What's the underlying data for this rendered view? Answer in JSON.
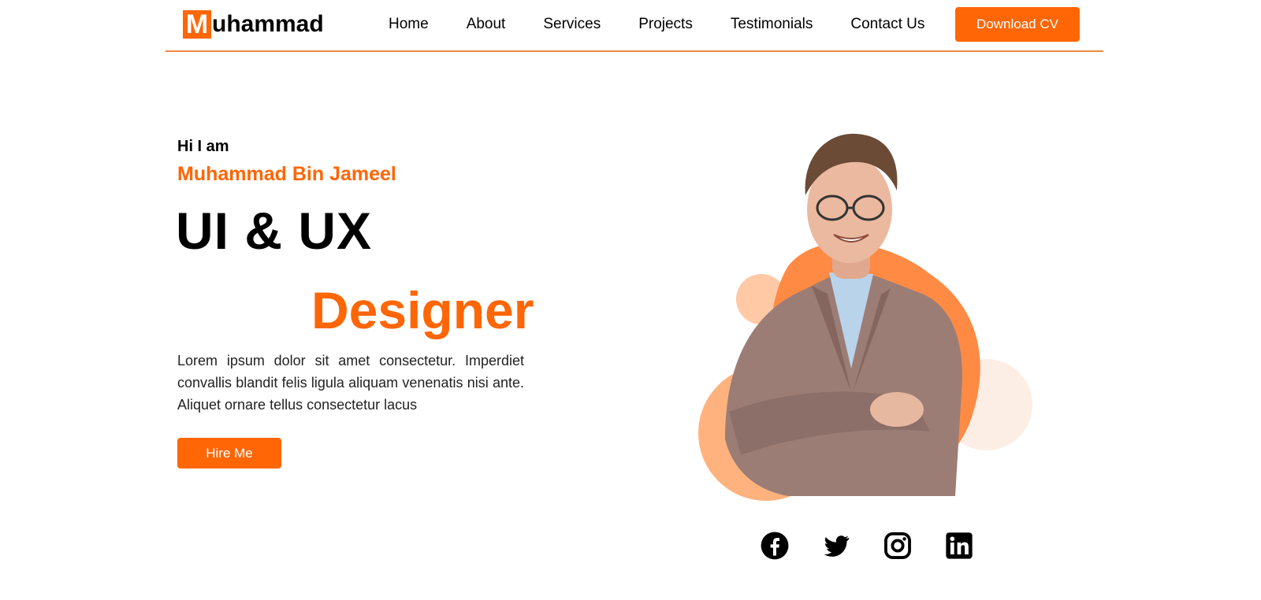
{
  "header": {
    "logo_initial": "M",
    "logo_rest": "uhammad",
    "nav": [
      "Home",
      "About",
      "Services",
      "Projects",
      "Testimonials",
      "Contact Us"
    ],
    "download_cv": "Download CV"
  },
  "hero": {
    "greeting": "Hi I am",
    "name": "Muhammad Bin Jameel",
    "role_line1": "UI & UX",
    "role_line2": "Designer",
    "description": "Lorem ipsum dolor sit amet consectetur. Imperdiet convallis blandit felis ligula aliquam venenatis nisi ante. Aliquet ornare tellus consectetur lacus",
    "hire_button": "Hire Me"
  },
  "socials": [
    "facebook-icon",
    "twitter-icon",
    "instagram-icon",
    "linkedin-icon"
  ],
  "colors": {
    "accent": "#ff6606",
    "accent_light": "#ffb27d",
    "accent_pale": "#fdeee5"
  }
}
